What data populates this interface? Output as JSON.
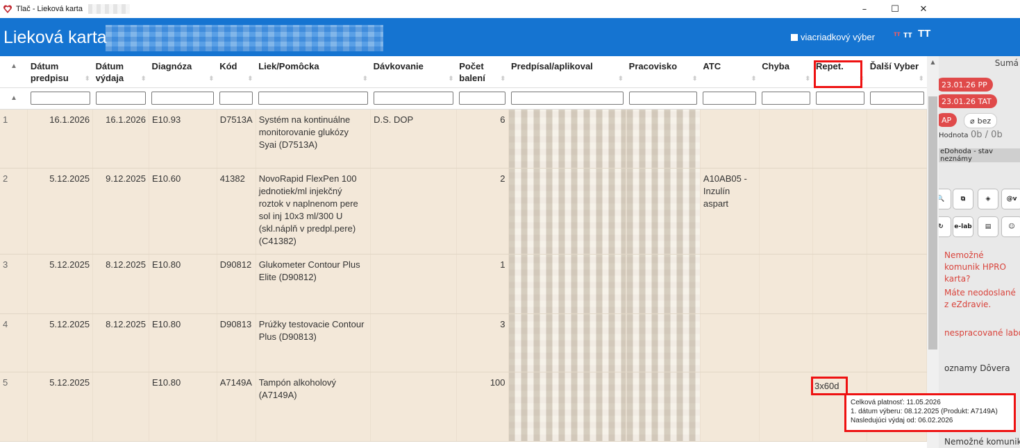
{
  "window": {
    "title": "Tlač - Lieková karta",
    "controls": [
      "–",
      "☐",
      "✕"
    ]
  },
  "header": {
    "heading": "Lieková karta",
    "multiselect_label": "viacriadkový výber",
    "font_sizes": [
      "ᴛᴛ",
      "тт",
      "TT"
    ]
  },
  "table": {
    "columns": [
      "Dátum predpisu",
      "Dátum výdaja",
      "Diagnóza",
      "Kód",
      "Liek/Pomôcka",
      "Dávkovanie",
      "Počet balení",
      "Predpísal/aplikoval",
      "Pracovisko",
      "ATC",
      "Chyba",
      "Repet.",
      "Ďalší Vyber"
    ],
    "rows": [
      {
        "n": "1",
        "predpis": "16.1.2026",
        "vydaj": "16.1.2026",
        "diag": "E10.93",
        "kod": "D7513A",
        "liek": "Systém na kontinuálne monitorovanie glukózy Syai (D7513A)",
        "davk": "D.S. DOP",
        "pocet": "6",
        "atc": "",
        "chyba": "",
        "repet": "",
        "dalsi": ""
      },
      {
        "n": "2",
        "predpis": "5.12.2025",
        "vydaj": "9.12.2025",
        "diag": "E10.60",
        "kod": "41382",
        "liek": "NovoRapid FlexPen 100 jednotiek/ml injekčný roztok v naplnenom pere sol inj 10x3 ml/300 U (skl.náplň v predpl.pere) (C41382)",
        "davk": "",
        "pocet": "2",
        "atc": "A10AB05 - Inzulín aspart",
        "chyba": "",
        "repet": "",
        "dalsi": ""
      },
      {
        "n": "3",
        "predpis": "5.12.2025",
        "vydaj": "8.12.2025",
        "diag": "E10.80",
        "kod": "D90812",
        "liek": "Glukometer Contour Plus Elite (D90812)",
        "davk": "",
        "pocet": "1",
        "atc": "",
        "chyba": "",
        "repet": "",
        "dalsi": ""
      },
      {
        "n": "4",
        "predpis": "5.12.2025",
        "vydaj": "8.12.2025",
        "diag": "E10.80",
        "kod": "D90813",
        "liek": "Prúžky testovacie Contour Plus (D90813)",
        "davk": "",
        "pocet": "3",
        "atc": "",
        "chyba": "",
        "repet": "",
        "dalsi": ""
      },
      {
        "n": "5",
        "predpis": "5.12.2025",
        "vydaj": "",
        "diag": "E10.80",
        "kod": "A7149A",
        "liek": "Tampón alkoholový (A7149A)",
        "davk": "",
        "pocet": "100",
        "atc": "",
        "chyba": "",
        "repet": "3x60d",
        "dalsi": ""
      }
    ]
  },
  "tooltip": {
    "line1": "Celková platnosť: 11.05.2026",
    "line2": "1. dátum výberu: 08.12.2025 (Produkt: A7149A)",
    "line3": "Nasledujúci výdaj od: 06.02.2026"
  },
  "side": {
    "suma": "Sumá",
    "pill1": "23.01.26 PP",
    "pill2": "23.01.26 TAT",
    "pill3": "AP",
    "pill4": "bez",
    "hodnota_label": "Hodnota",
    "hodnota_val": "0b / 0b",
    "edohoda": "eDohoda - stav neznámy",
    "elab": "e-lab",
    "tile_at": "@v",
    "msg1": "Nemožné komunik HPRO karta?",
    "msg2": "Máte neodoslané z eZdravie.",
    "msg3": "nespracované labo",
    "msg4": "oznamy Dôvera",
    "msg5": "Nemožné komunik"
  },
  "colors": {
    "header": "#1574d1",
    "row_bg": "#f3e8d9",
    "highlight": "#ee1111"
  }
}
